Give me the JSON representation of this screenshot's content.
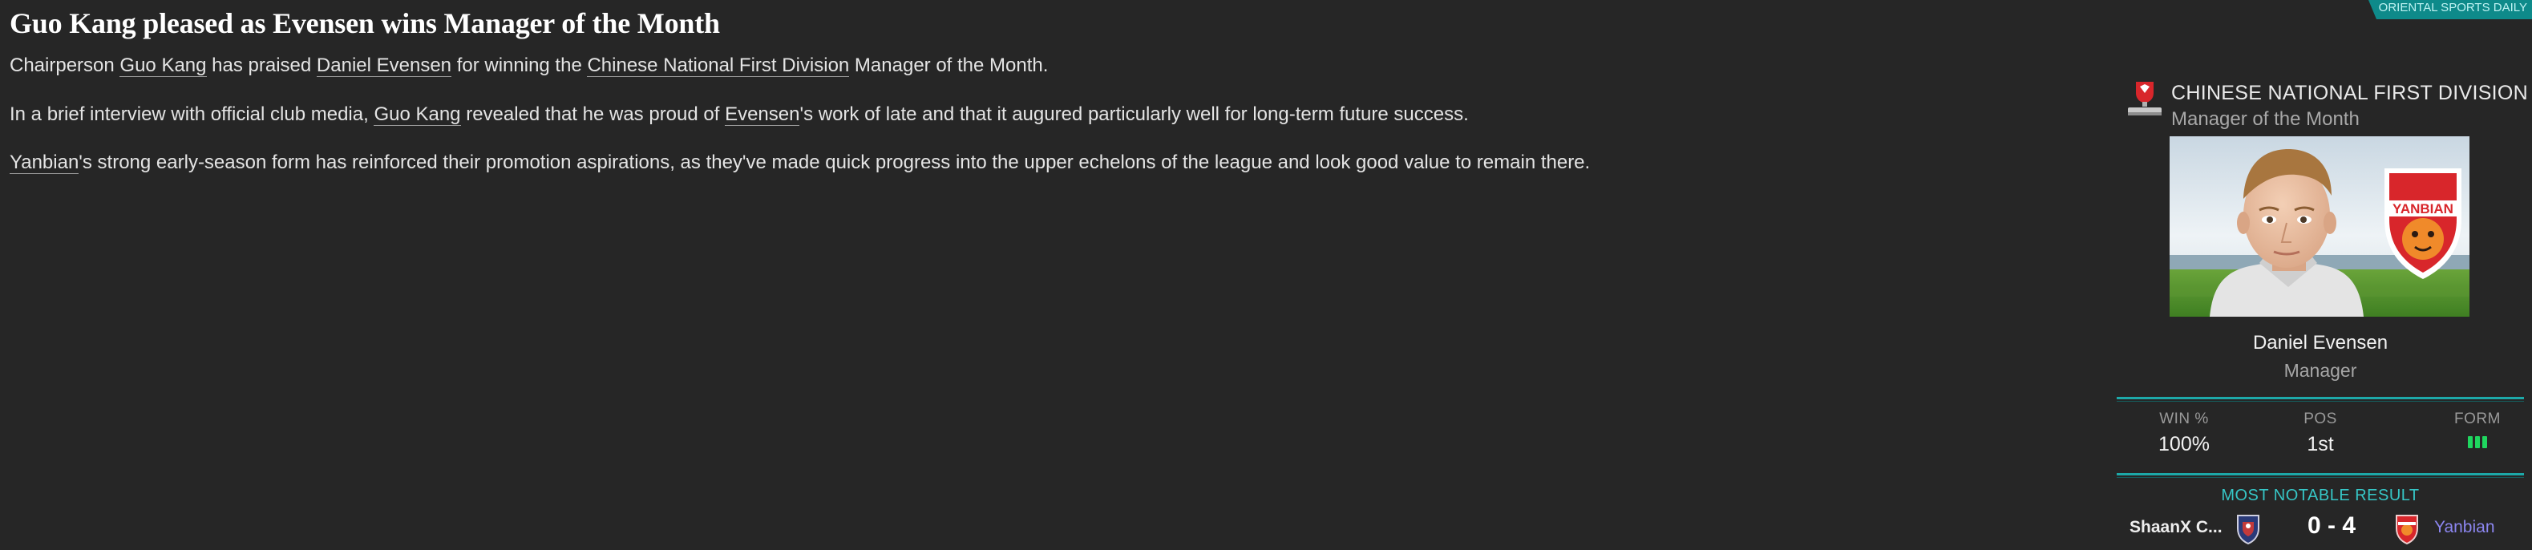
{
  "source": {
    "name": "ORIENTAL SPORTS DAILY"
  },
  "article": {
    "headline": "Guo Kang pleased as Evensen wins Manager of the Month",
    "p1": {
      "t1": "Chairperson ",
      "l1": "Guo Kang",
      "t2": " has praised ",
      "l2": "Daniel Evensen",
      "t3": " for winning the ",
      "l3": "Chinese National First Division",
      "t4": " Manager of the Month."
    },
    "p2": {
      "t1": "In a brief interview with official club media, ",
      "l1": "Guo Kang",
      "t2": " revealed that he was proud of ",
      "l2": "Evensen",
      "t3": "'s work of late and that it augured particularly well for long-term future success."
    },
    "p3": {
      "l1": "Yanbian",
      "t1": "'s strong early-season form has reinforced their promotion aspirations, as they've made quick progress into the upper echelons of the league and look good value to remain there."
    }
  },
  "award": {
    "competition": "CHINESE NATIONAL FIRST DIVISION",
    "title": "Manager of the Month",
    "icon": "trophy-icon"
  },
  "person": {
    "name": "Daniel Evensen",
    "role": "Manager",
    "club_badge_text": "YANBIAN"
  },
  "stats": {
    "win_label": "WIN %",
    "win_value": "100%",
    "pos_label": "POS",
    "pos_value": "1st",
    "form_label": "FORM",
    "form": [
      "W",
      "W",
      "W"
    ],
    "form_color": "#1fd65f"
  },
  "notable": {
    "label": "MOST NOTABLE RESULT",
    "home_team": "ShaanX C...",
    "score": "0 - 4",
    "away_team": "Yanbian",
    "away_color": "#8c86f0"
  },
  "colors": {
    "background": "#262626",
    "accent": "#1da9a9"
  }
}
